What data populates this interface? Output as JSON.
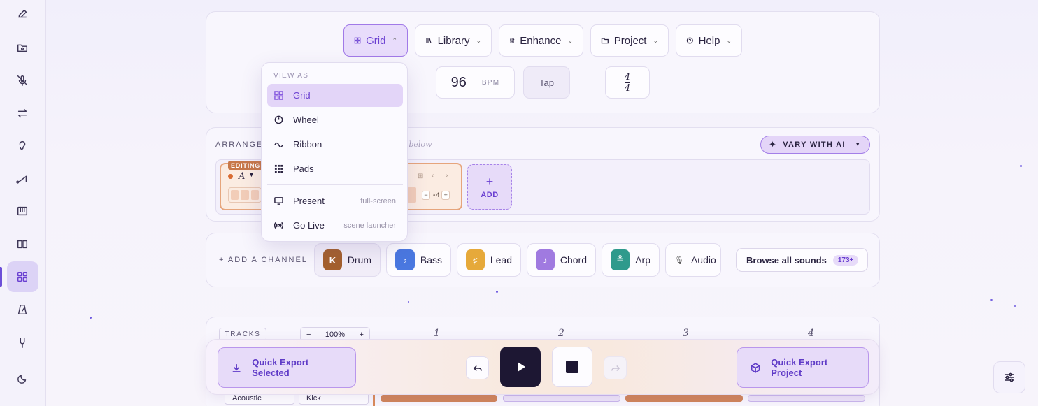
{
  "toolbar": {
    "grid": "Grid",
    "library": "Library",
    "enhance": "Enhance",
    "project": "Project",
    "help": "Help"
  },
  "tempo": {
    "bpm": "96",
    "bpm_unit": "BPM",
    "tap": "Tap",
    "time_sig_top": "4",
    "time_sig_bottom": "4"
  },
  "view_menu": {
    "heading": "VIEW AS",
    "items": [
      {
        "label": "Grid",
        "icon": "grid-icon",
        "selected": true
      },
      {
        "label": "Wheel",
        "icon": "clock-icon"
      },
      {
        "label": "Ribbon",
        "icon": "wave-icon"
      },
      {
        "label": "Pads",
        "icon": "pads-icon"
      }
    ],
    "extras": [
      {
        "label": "Present",
        "hint": "full-screen",
        "icon": "monitor-icon"
      },
      {
        "label": "Go Live",
        "hint": "scene launcher",
        "icon": "broadcast-icon"
      }
    ]
  },
  "arrangement": {
    "label": "ARRANGEM",
    "hint": "at below",
    "vary_label": "VARY WITH AI",
    "editing_badge": "EDITING",
    "section_letter": "A",
    "repeat": "×4",
    "minus": "−",
    "plus": "+",
    "add_label": "ADD",
    "add_plus": "+"
  },
  "channels": {
    "add_label": "+ ADD A CHANNEL",
    "items": [
      {
        "label": "Drum",
        "glyph": "K",
        "color": "#a4602e"
      },
      {
        "label": "Bass",
        "glyph": "♭",
        "color": "#4a78e0"
      },
      {
        "label": "Lead",
        "glyph": "♯",
        "color": "#e6a93a"
      },
      {
        "label": "Chord",
        "glyph": "♪",
        "color": "#a07ae0"
      },
      {
        "label": "Arp",
        "glyph": "≗",
        "color": "#2f9a8c"
      },
      {
        "label": "Audio",
        "glyph": "🎙",
        "color": "#ffffff"
      }
    ],
    "browse_label": "Browse all sounds",
    "browse_count": "173+"
  },
  "tracks": {
    "label": "TRACKS",
    "zoom": "100%",
    "zoom_minus": "−",
    "zoom_plus": "+",
    "bars": [
      "1",
      "2",
      "3",
      "4"
    ],
    "track_select": "Acoustic",
    "instrument_select": "Kick"
  },
  "transport": {
    "export_selected": "Quick Export Selected",
    "export_project": "Quick Export Project"
  },
  "colors": {
    "accent": "#6a3fd1",
    "accent_soft": "#e7dbf9",
    "editing": "#e39a6a"
  }
}
